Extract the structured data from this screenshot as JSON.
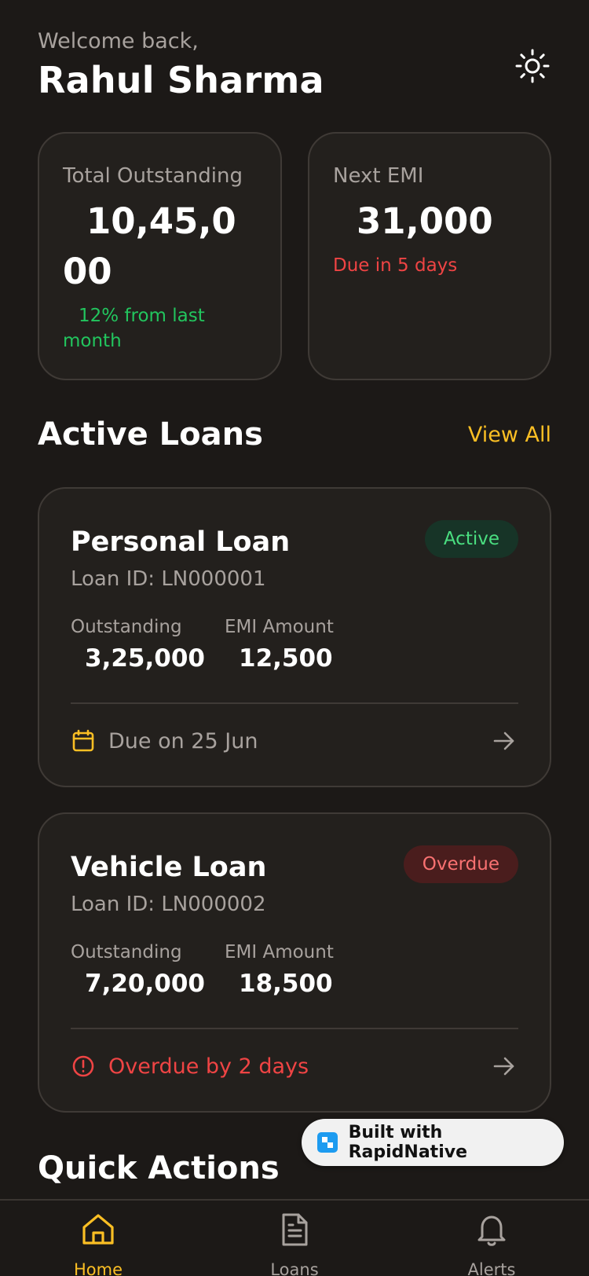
{
  "header": {
    "welcome": "Welcome back,",
    "user_name": "Rahul Sharma",
    "theme_icon": "sun-icon"
  },
  "stats": {
    "outstanding": {
      "label": "Total Outstanding",
      "value": "10,45,000",
      "change": "12% from last month",
      "change_color": "#22c55e"
    },
    "next_emi": {
      "label": "Next EMI",
      "value": "31,000",
      "due": "Due in 5 days",
      "due_color": "#ef4444"
    }
  },
  "active_loans": {
    "title": "Active Loans",
    "view_all": "View All",
    "loans": [
      {
        "name": "Personal Loan",
        "loan_id": "Loan ID: LN000001",
        "status": "Active",
        "outstanding_label": "Outstanding",
        "outstanding": "3,25,000",
        "emi_label": "EMI Amount",
        "emi": "12,500",
        "footer_icon": "calendar-icon",
        "footer_text": "Due on 25 Jun"
      },
      {
        "name": "Vehicle Loan",
        "loan_id": "Loan ID: LN000002",
        "status": "Overdue",
        "outstanding_label": "Outstanding",
        "outstanding": "7,20,000",
        "emi_label": "EMI Amount",
        "emi": "18,500",
        "footer_icon": "alert-circle-icon",
        "footer_text": "Overdue by 2 days"
      }
    ]
  },
  "quick_actions": {
    "title": "Quick Actions"
  },
  "badge": {
    "text": "Built with RapidNative"
  },
  "tabs": [
    {
      "label": "Home",
      "icon": "home-icon",
      "active": true
    },
    {
      "label": "Loans",
      "icon": "document-icon",
      "active": false
    },
    {
      "label": "Alerts",
      "icon": "bell-icon",
      "active": false
    }
  ],
  "colors": {
    "background": "#1c1917",
    "card": "#23201d",
    "accent": "#fbbf24",
    "success": "#22c55e",
    "danger": "#ef4444"
  }
}
